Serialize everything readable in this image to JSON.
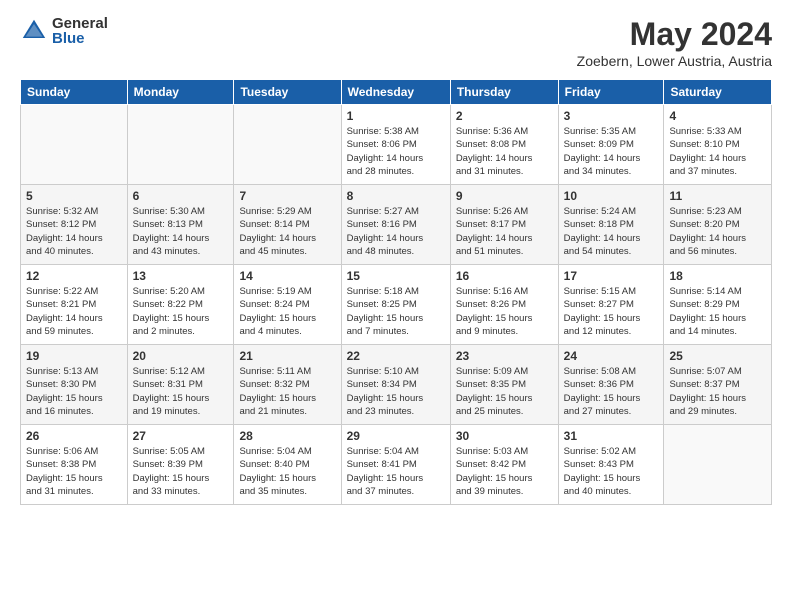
{
  "logo": {
    "general": "General",
    "blue": "Blue"
  },
  "header": {
    "title": "May 2024",
    "subtitle": "Zoebern, Lower Austria, Austria"
  },
  "weekdays": [
    "Sunday",
    "Monday",
    "Tuesday",
    "Wednesday",
    "Thursday",
    "Friday",
    "Saturday"
  ],
  "rows": [
    [
      {
        "day": "",
        "info": ""
      },
      {
        "day": "",
        "info": ""
      },
      {
        "day": "",
        "info": ""
      },
      {
        "day": "1",
        "info": "Sunrise: 5:38 AM\nSunset: 8:06 PM\nDaylight: 14 hours\nand 28 minutes."
      },
      {
        "day": "2",
        "info": "Sunrise: 5:36 AM\nSunset: 8:08 PM\nDaylight: 14 hours\nand 31 minutes."
      },
      {
        "day": "3",
        "info": "Sunrise: 5:35 AM\nSunset: 8:09 PM\nDaylight: 14 hours\nand 34 minutes."
      },
      {
        "day": "4",
        "info": "Sunrise: 5:33 AM\nSunset: 8:10 PM\nDaylight: 14 hours\nand 37 minutes."
      }
    ],
    [
      {
        "day": "5",
        "info": "Sunrise: 5:32 AM\nSunset: 8:12 PM\nDaylight: 14 hours\nand 40 minutes."
      },
      {
        "day": "6",
        "info": "Sunrise: 5:30 AM\nSunset: 8:13 PM\nDaylight: 14 hours\nand 43 minutes."
      },
      {
        "day": "7",
        "info": "Sunrise: 5:29 AM\nSunset: 8:14 PM\nDaylight: 14 hours\nand 45 minutes."
      },
      {
        "day": "8",
        "info": "Sunrise: 5:27 AM\nSunset: 8:16 PM\nDaylight: 14 hours\nand 48 minutes."
      },
      {
        "day": "9",
        "info": "Sunrise: 5:26 AM\nSunset: 8:17 PM\nDaylight: 14 hours\nand 51 minutes."
      },
      {
        "day": "10",
        "info": "Sunrise: 5:24 AM\nSunset: 8:18 PM\nDaylight: 14 hours\nand 54 minutes."
      },
      {
        "day": "11",
        "info": "Sunrise: 5:23 AM\nSunset: 8:20 PM\nDaylight: 14 hours\nand 56 minutes."
      }
    ],
    [
      {
        "day": "12",
        "info": "Sunrise: 5:22 AM\nSunset: 8:21 PM\nDaylight: 14 hours\nand 59 minutes."
      },
      {
        "day": "13",
        "info": "Sunrise: 5:20 AM\nSunset: 8:22 PM\nDaylight: 15 hours\nand 2 minutes."
      },
      {
        "day": "14",
        "info": "Sunrise: 5:19 AM\nSunset: 8:24 PM\nDaylight: 15 hours\nand 4 minutes."
      },
      {
        "day": "15",
        "info": "Sunrise: 5:18 AM\nSunset: 8:25 PM\nDaylight: 15 hours\nand 7 minutes."
      },
      {
        "day": "16",
        "info": "Sunrise: 5:16 AM\nSunset: 8:26 PM\nDaylight: 15 hours\nand 9 minutes."
      },
      {
        "day": "17",
        "info": "Sunrise: 5:15 AM\nSunset: 8:27 PM\nDaylight: 15 hours\nand 12 minutes."
      },
      {
        "day": "18",
        "info": "Sunrise: 5:14 AM\nSunset: 8:29 PM\nDaylight: 15 hours\nand 14 minutes."
      }
    ],
    [
      {
        "day": "19",
        "info": "Sunrise: 5:13 AM\nSunset: 8:30 PM\nDaylight: 15 hours\nand 16 minutes."
      },
      {
        "day": "20",
        "info": "Sunrise: 5:12 AM\nSunset: 8:31 PM\nDaylight: 15 hours\nand 19 minutes."
      },
      {
        "day": "21",
        "info": "Sunrise: 5:11 AM\nSunset: 8:32 PM\nDaylight: 15 hours\nand 21 minutes."
      },
      {
        "day": "22",
        "info": "Sunrise: 5:10 AM\nSunset: 8:34 PM\nDaylight: 15 hours\nand 23 minutes."
      },
      {
        "day": "23",
        "info": "Sunrise: 5:09 AM\nSunset: 8:35 PM\nDaylight: 15 hours\nand 25 minutes."
      },
      {
        "day": "24",
        "info": "Sunrise: 5:08 AM\nSunset: 8:36 PM\nDaylight: 15 hours\nand 27 minutes."
      },
      {
        "day": "25",
        "info": "Sunrise: 5:07 AM\nSunset: 8:37 PM\nDaylight: 15 hours\nand 29 minutes."
      }
    ],
    [
      {
        "day": "26",
        "info": "Sunrise: 5:06 AM\nSunset: 8:38 PM\nDaylight: 15 hours\nand 31 minutes."
      },
      {
        "day": "27",
        "info": "Sunrise: 5:05 AM\nSunset: 8:39 PM\nDaylight: 15 hours\nand 33 minutes."
      },
      {
        "day": "28",
        "info": "Sunrise: 5:04 AM\nSunset: 8:40 PM\nDaylight: 15 hours\nand 35 minutes."
      },
      {
        "day": "29",
        "info": "Sunrise: 5:04 AM\nSunset: 8:41 PM\nDaylight: 15 hours\nand 37 minutes."
      },
      {
        "day": "30",
        "info": "Sunrise: 5:03 AM\nSunset: 8:42 PM\nDaylight: 15 hours\nand 39 minutes."
      },
      {
        "day": "31",
        "info": "Sunrise: 5:02 AM\nSunset: 8:43 PM\nDaylight: 15 hours\nand 40 minutes."
      },
      {
        "day": "",
        "info": ""
      }
    ]
  ]
}
